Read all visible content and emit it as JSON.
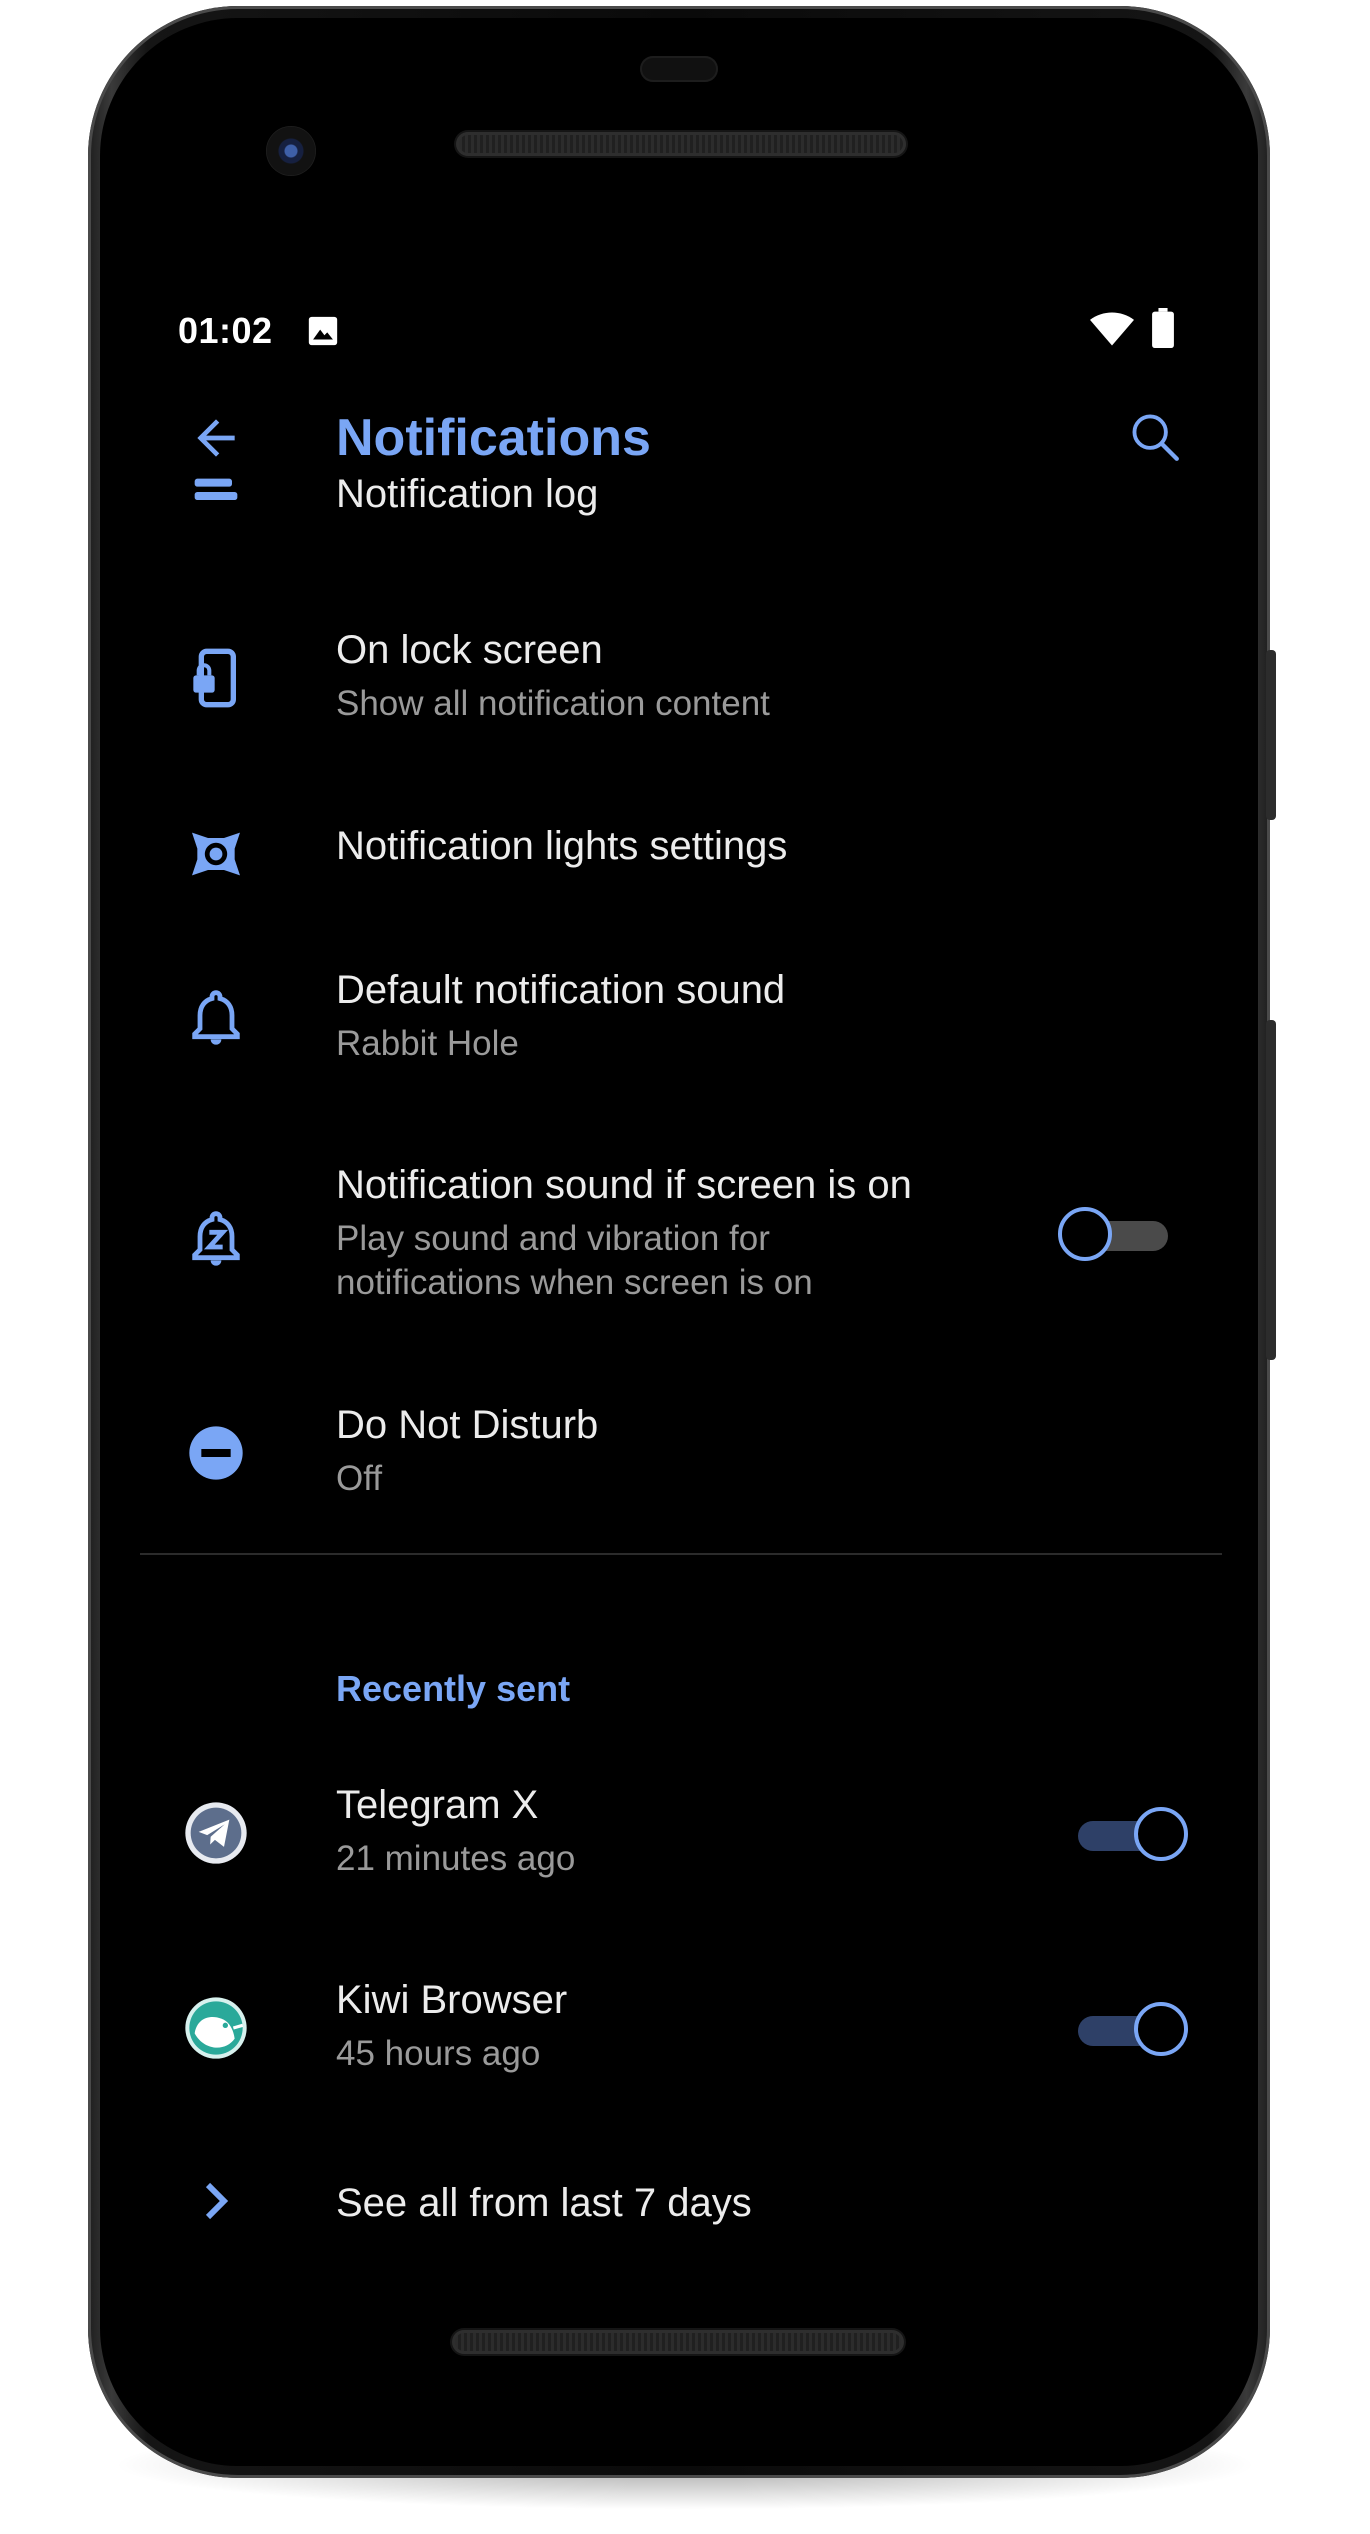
{
  "status_bar": {
    "time": "01:02"
  },
  "app_bar": {
    "title": "Notifications"
  },
  "settings": {
    "notification_log": {
      "title": "Notification log"
    },
    "lock_screen": {
      "title": "On lock screen",
      "subtitle": "Show all notification content"
    },
    "lights": {
      "title": "Notification lights settings"
    },
    "default_sound": {
      "title": "Default notification sound",
      "subtitle": "Rabbit Hole"
    },
    "sound_screen_on": {
      "title": "Notification sound if screen is on",
      "subtitle_line1": "Play sound and vibration for",
      "subtitle_line2": "notifications when screen is on",
      "enabled": false
    },
    "dnd": {
      "title": "Do Not Disturb",
      "subtitle": "Off"
    }
  },
  "recently_sent": {
    "header": "Recently sent",
    "apps": [
      {
        "name": "Telegram X",
        "time": "21 minutes ago",
        "enabled": true
      },
      {
        "name": "Kiwi Browser",
        "time": "45 hours ago",
        "enabled": true
      }
    ],
    "see_all": "See all from last 7 days"
  },
  "colors": {
    "accent": "#7aa6f5",
    "background": "#000000",
    "primary_text": "#ececec",
    "secondary_text": "#9a9a9a"
  }
}
